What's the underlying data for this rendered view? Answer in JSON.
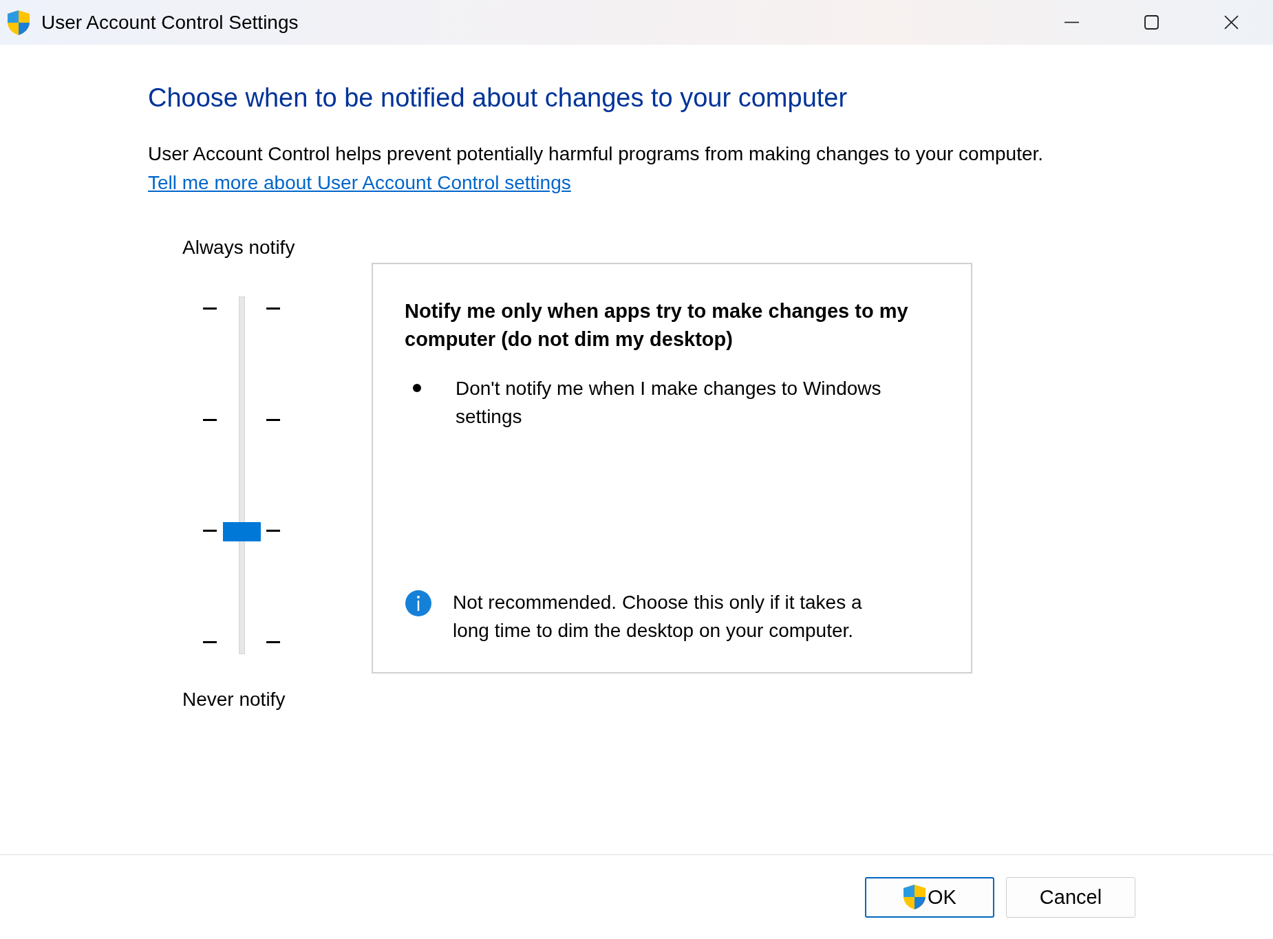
{
  "window": {
    "title": "User Account Control Settings"
  },
  "heading": "Choose when to be notified about changes to your computer",
  "description": "User Account Control helps prevent potentially harmful programs from making changes to your computer.",
  "link": "Tell me more about User Account Control settings",
  "slider": {
    "top_label": "Always notify",
    "bottom_label": "Never notify",
    "level": 0.3333
  },
  "setting": {
    "title": "Notify me only when apps try to make changes to my computer (do not dim my desktop)",
    "bullets": [
      "Don't notify me when I make changes to Windows settings"
    ],
    "note": "Not recommended. Choose this only if it takes a long time to dim the desktop on your computer."
  },
  "buttons": [
    {
      "label": "OK",
      "kind": "shield",
      "default": true
    },
    {
      "label": "Cancel",
      "kind": "plain",
      "default": false
    }
  ]
}
